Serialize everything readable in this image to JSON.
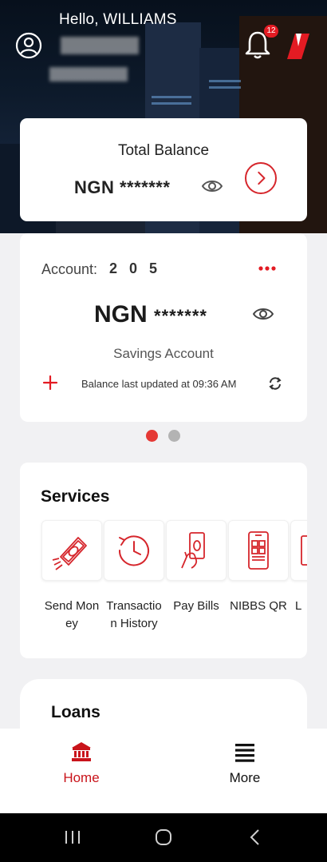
{
  "header": {
    "greeting": "Hello, WILLIAMS",
    "notification_count": "12",
    "logo_icon": "uba-logo-icon"
  },
  "total_balance": {
    "title": "Total Balance",
    "amount": "NGN *******"
  },
  "account": {
    "label": "Account:",
    "number": "2 0 5",
    "currency": "NGN",
    "masked_balance": "*******",
    "type": "Savings Account",
    "last_updated": "Balance last updated at 09:36 AM"
  },
  "carousel": {
    "pages": 2,
    "active": 0
  },
  "services": {
    "title": "Services",
    "items": [
      {
        "label": "Send Money",
        "icon": "send-money-icon"
      },
      {
        "label": "Transaction History",
        "icon": "history-icon"
      },
      {
        "label": "Pay Bills",
        "icon": "pay-bills-icon"
      },
      {
        "label": "NIBBS QR",
        "icon": "qr-phone-icon"
      },
      {
        "label": "L",
        "icon": "partial-service-icon"
      }
    ]
  },
  "loans": {
    "title": "Loans"
  },
  "nav": {
    "home_label": "Home",
    "more_label": "More"
  },
  "colors": {
    "accent": "#e31b23",
    "text_dark": "#222222"
  }
}
